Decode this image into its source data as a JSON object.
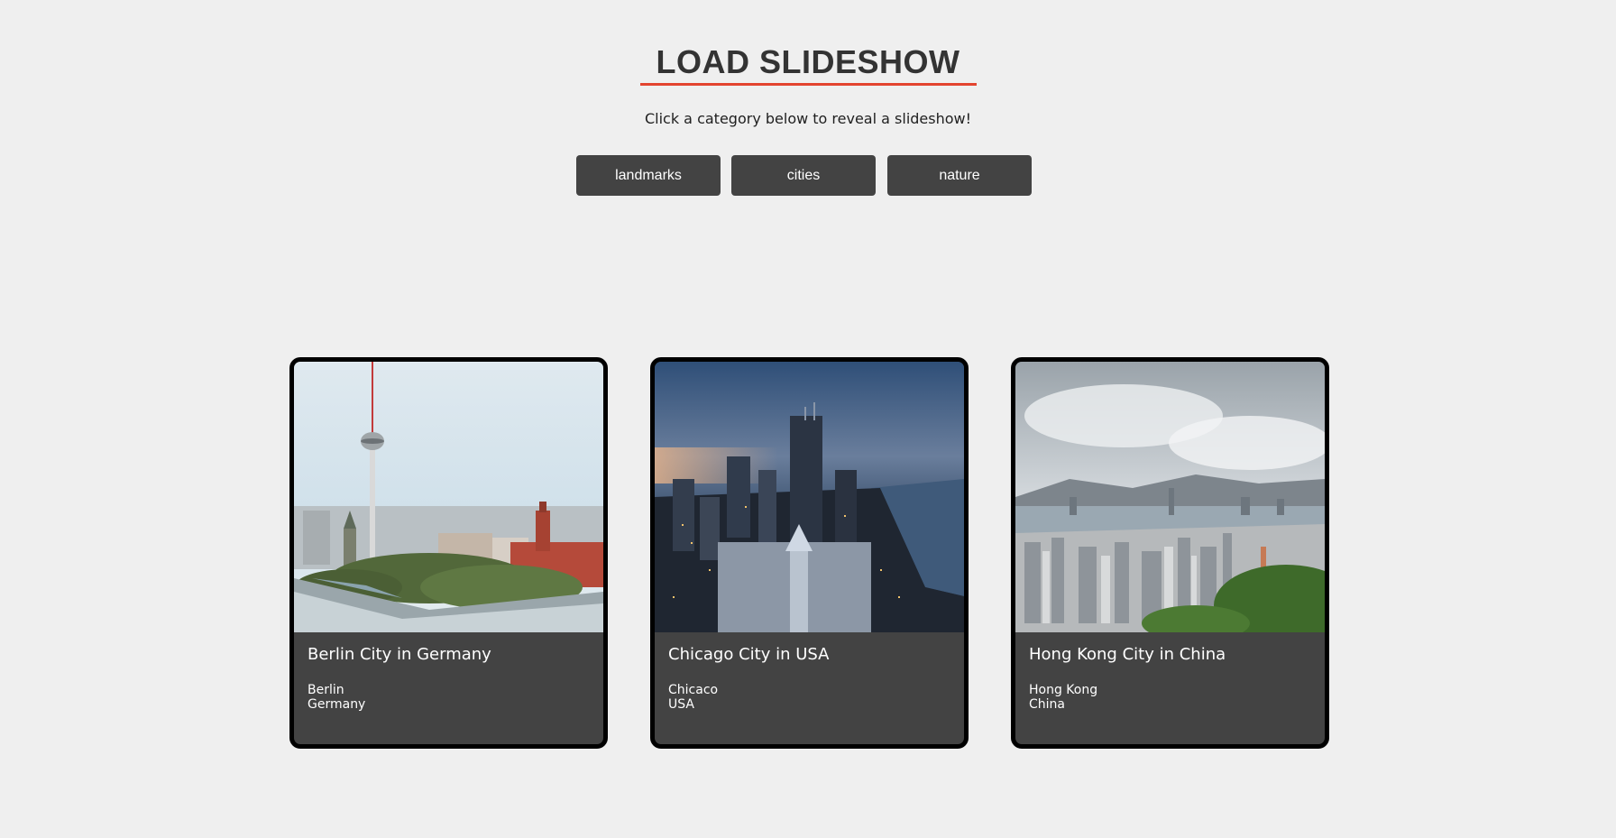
{
  "header": {
    "title": "LOAD SLIDESHOW",
    "subtitle": "Click a category below to reveal a slideshow!"
  },
  "categories": [
    {
      "label": "landmarks"
    },
    {
      "label": "cities"
    },
    {
      "label": "nature"
    }
  ],
  "cards": [
    {
      "title": "Berlin City in Germany",
      "city": "Berlin",
      "country": "Germany"
    },
    {
      "title": "Chicago City in USA",
      "city": "Chicaco",
      "country": "USA"
    },
    {
      "title": "Hong Kong City in China",
      "city": "Hong Kong",
      "country": "China"
    }
  ],
  "colors": {
    "background": "#efefef",
    "button": "#434343",
    "accent_underline": "#e3442f",
    "card_border": "#000000",
    "card_body": "#434343"
  }
}
